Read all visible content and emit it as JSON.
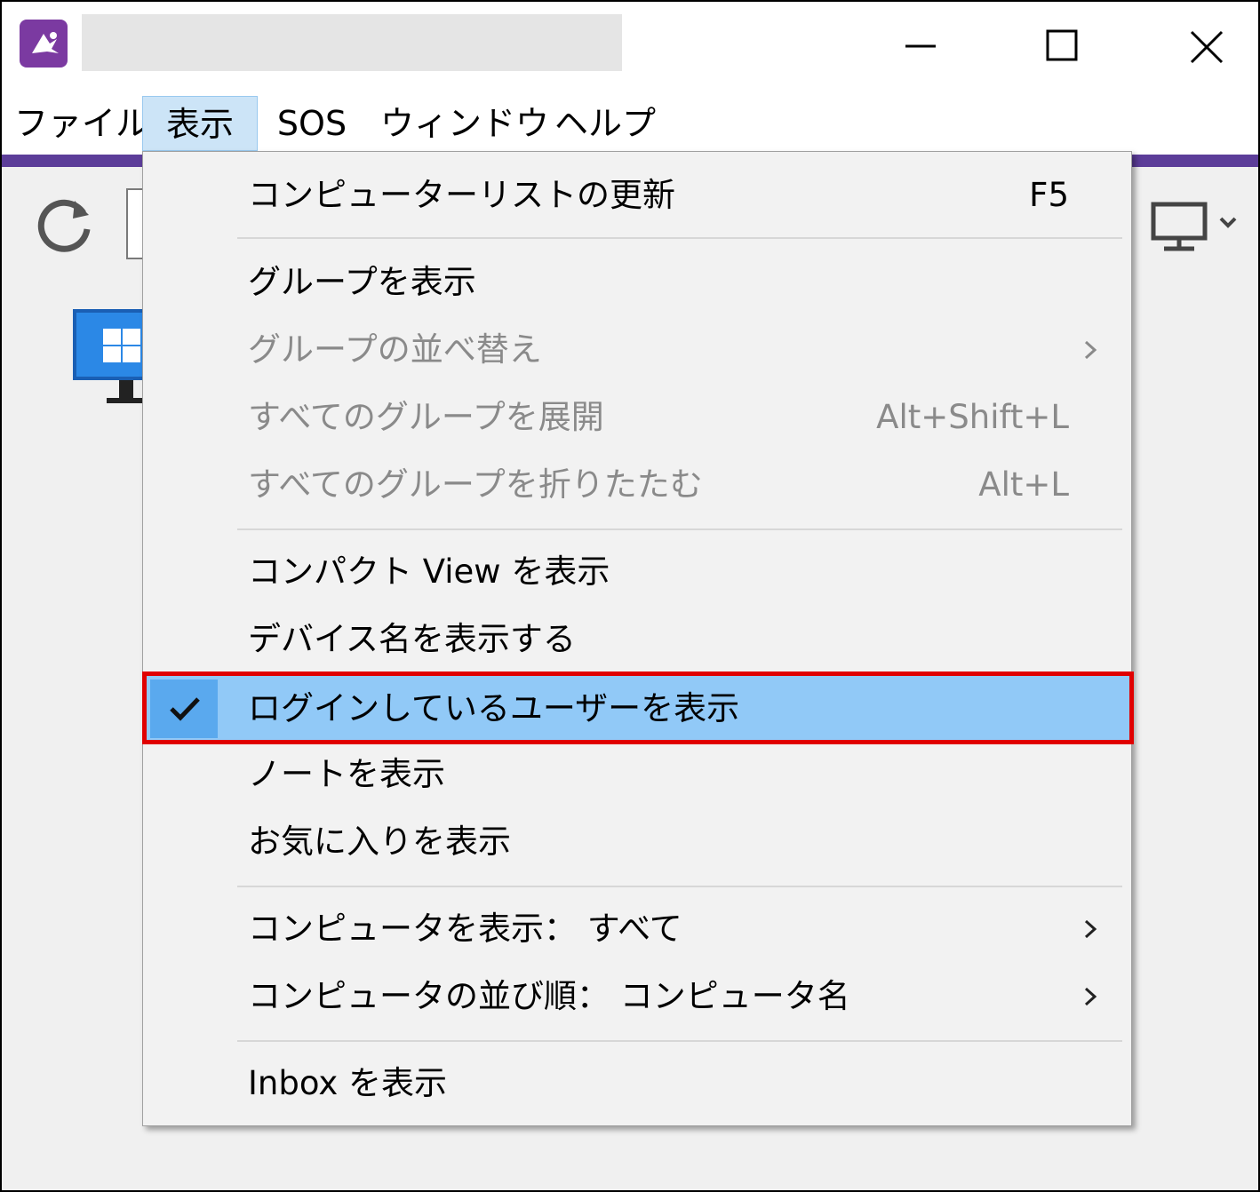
{
  "window": {
    "controls": {
      "minimize_icon": "minimize-icon",
      "maximize_icon": "maximize-icon",
      "close_icon": "close-icon"
    }
  },
  "menubar": {
    "items": [
      {
        "label": "ファイル"
      },
      {
        "label": "表示",
        "active": true
      },
      {
        "label": "SOS"
      },
      {
        "label": "ウィンドウ"
      },
      {
        "label": "ヘルプ"
      }
    ]
  },
  "toolbar": {
    "refresh_icon": "refresh-icon",
    "view_toggle_icon": "monitor-icon"
  },
  "view_menu": {
    "items": [
      {
        "label": "コンピューターリストの更新",
        "shortcut": "F5",
        "enabled": true
      },
      {
        "label": "グループを表示",
        "enabled": true
      },
      {
        "label": "グループの並べ替え",
        "enabled": false,
        "submenu": true
      },
      {
        "label": "すべてのグループを展開",
        "shortcut": "Alt+Shift+L",
        "enabled": false
      },
      {
        "label": "すべてのグループを折りたたむ",
        "shortcut": "Alt+L",
        "enabled": false
      },
      {
        "label": "コンパクト View を表示",
        "enabled": true
      },
      {
        "label": "デバイス名を表示する",
        "enabled": true
      },
      {
        "label": "ログインしているユーザーを表示",
        "enabled": true,
        "checked": true,
        "highlighted": true
      },
      {
        "label": "ノートを表示",
        "enabled": true
      },
      {
        "label": "お気に入りを表示",
        "enabled": true
      },
      {
        "label": "コンピュータを表示： すべて",
        "enabled": true,
        "submenu": true
      },
      {
        "label": "コンピュータの並び順： コンピュータ名",
        "enabled": true,
        "submenu": true
      },
      {
        "label": "Inbox を表示",
        "enabled": true
      }
    ]
  },
  "colors": {
    "accent_purple": "#5c3d99",
    "menu_highlight": "#91c9f7",
    "check_highlight": "#5aa9ee",
    "annotation_red": "#e00000",
    "disabled_text": "#8a8a8a"
  }
}
